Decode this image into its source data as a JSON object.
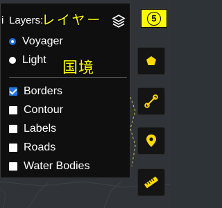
{
  "panel": {
    "title_prefix": "i",
    "title": "Layers:",
    "icon": "layers-stack-icon"
  },
  "basemaps": [
    {
      "label": "Voyager",
      "selected": true
    },
    {
      "label": "Light",
      "selected": false
    }
  ],
  "overlays": [
    {
      "label": "Borders",
      "checked": true
    },
    {
      "label": "Contour",
      "checked": false
    },
    {
      "label": "Labels",
      "checked": false
    },
    {
      "label": "Roads",
      "checked": false
    },
    {
      "label": "Water Bodies",
      "checked": false
    }
  ],
  "annotations": {
    "layer_jp": "レイヤー",
    "border_jp": "国境",
    "step": "5",
    "color": "#ffff00"
  },
  "toolbar": [
    {
      "icon": "polygon-icon"
    },
    {
      "icon": "polyline-icon"
    },
    {
      "icon": "marker-icon"
    },
    {
      "icon": "ruler-icon"
    }
  ],
  "colors": {
    "accent": "#ffd900",
    "check_blue": "#1f7ae8",
    "panel_bg": "#0f0f10"
  }
}
